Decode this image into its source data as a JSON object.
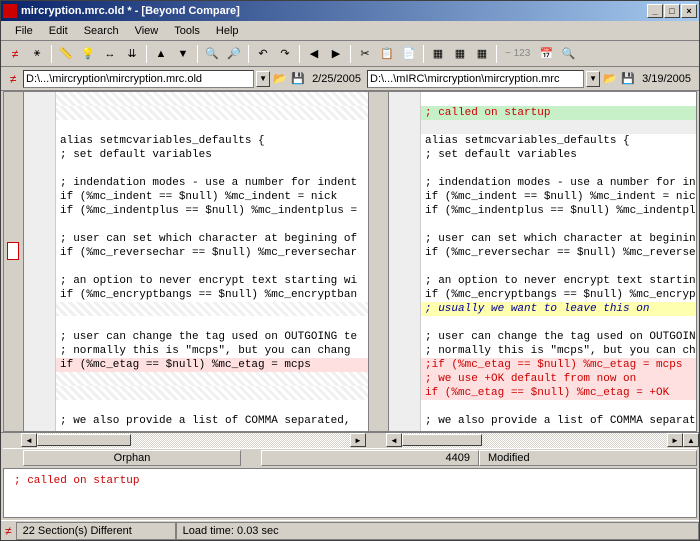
{
  "title": "mircryption.mrc.old * - [Beyond Compare]",
  "menu": [
    "File",
    "Edit",
    "Search",
    "View",
    "Tools",
    "Help"
  ],
  "toolbar_text": "~ 123",
  "paths": {
    "left": {
      "text": "D:\\...\\mircryption\\mircryption.mrc.old",
      "date": "2/25/2005"
    },
    "right": {
      "text": "D:\\...\\mIRC\\mircryption\\mircryption.mrc",
      "date": "3/19/2005"
    }
  },
  "left_lines": [
    {
      "t": "",
      "cls": "hatched"
    },
    {
      "t": "",
      "cls": "hatched"
    },
    {
      "t": "",
      "cls": "blank"
    },
    {
      "t": "alias setmcvariables_defaults {",
      "cls": ""
    },
    {
      "t": "  ; set default variables",
      "cls": ""
    },
    {
      "t": "",
      "cls": "blank"
    },
    {
      "t": "  ; indendation modes - use a number for indent",
      "cls": ""
    },
    {
      "t": "  if (%mc_indent == $null) %mc_indent = nick",
      "cls": ""
    },
    {
      "t": "  if (%mc_indentplus == $null) %mc_indentplus =",
      "cls": ""
    },
    {
      "t": "",
      "cls": "blank"
    },
    {
      "t": "  ; user can set which character at begining of",
      "cls": ""
    },
    {
      "t": "  if (%mc_reversechar == $null) %mc_reversechar",
      "cls": ""
    },
    {
      "t": "",
      "cls": "blank"
    },
    {
      "t": "  ; an option to never encrypt text starting wi",
      "cls": ""
    },
    {
      "t": "  if (%mc_encryptbangs == $null) %mc_encryptban",
      "cls": ""
    },
    {
      "t": "",
      "cls": "hatched"
    },
    {
      "t": "",
      "cls": "blank"
    },
    {
      "t": "  ; user can change the tag used on OUTGOING te",
      "cls": ""
    },
    {
      "t": "  ; normally this is \"mcps\", but you can chang",
      "cls": ""
    },
    {
      "t": "  if (%mc_etag == $null) %mc_etag = mcps",
      "cls": "pink"
    },
    {
      "t": "",
      "cls": "hatched"
    },
    {
      "t": "",
      "cls": "hatched"
    },
    {
      "t": "",
      "cls": "blank"
    },
    {
      "t": "  ; we also provide a list of COMMA separated,",
      "cls": ""
    }
  ],
  "right_lines": [
    {
      "t": "",
      "cls": "blank"
    },
    {
      "t": "; called on startup",
      "cls": "green red"
    },
    {
      "t": "",
      "cls": "gray"
    },
    {
      "t": "alias setmcvariables_defaults {",
      "cls": ""
    },
    {
      "t": "  ; set default variables",
      "cls": ""
    },
    {
      "t": "",
      "cls": "blank"
    },
    {
      "t": "  ; indendation modes - use a number for indent",
      "cls": ""
    },
    {
      "t": "  if (%mc_indent == $null) %mc_indent = nick",
      "cls": ""
    },
    {
      "t": "  if (%mc_indentplus == $null) %mc_indentplus =",
      "cls": ""
    },
    {
      "t": "",
      "cls": "blank"
    },
    {
      "t": "  ; user can set which character at begining of",
      "cls": ""
    },
    {
      "t": "  if (%mc_reversechar == $null) %mc_reversechar",
      "cls": ""
    },
    {
      "t": "",
      "cls": "blank"
    },
    {
      "t": "  ; an option to never encrypt text starting wi",
      "cls": ""
    },
    {
      "t": "  if (%mc_encryptbangs == $null) %mc_encryptban",
      "cls": ""
    },
    {
      "t": "  ; usually we want to leave this on",
      "cls": "yellow"
    },
    {
      "t": "",
      "cls": "blank"
    },
    {
      "t": "  ; user can change the tag used on OUTGOING te",
      "cls": ""
    },
    {
      "t": "  ; normally this is \"mcps\", but you can chang",
      "cls": ""
    },
    {
      "t": "  ;if (%mc_etag == $null) %mc_etag = mcps",
      "cls": "pink red"
    },
    {
      "t": "  ; we use +OK default from now on",
      "cls": "pink red"
    },
    {
      "t": "  if (%mc_etag == $null) %mc_etag = +OK",
      "cls": "pink red"
    },
    {
      "t": "",
      "cls": "blank"
    },
    {
      "t": "  ; we also provide a list of COMMA separated,",
      "cls": ""
    }
  ],
  "inner_status": {
    "left": "Orphan",
    "right_num": "4409",
    "right_state": "Modified"
  },
  "bottom_text": "; called on startup",
  "final_status": {
    "sections": "22 Section(s) Different",
    "loadtime": "Load time:   0.03 sec"
  }
}
